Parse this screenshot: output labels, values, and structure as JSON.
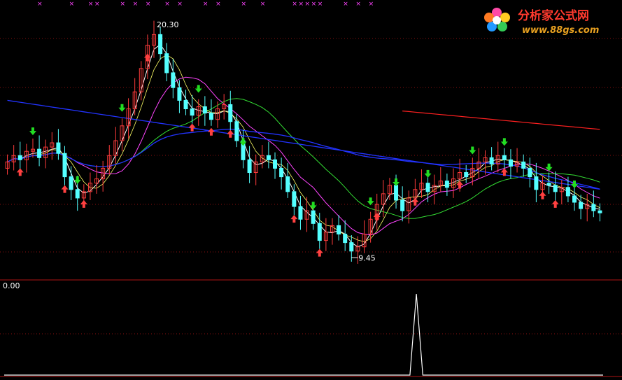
{
  "logo": {
    "title": "分析家公式网",
    "url": "www.88gs.com",
    "title_color": "#ff3a2e",
    "url_color": "#e8a020"
  },
  "indicator": {
    "value_label": "0.00"
  },
  "annotations": {
    "high_label": "20.30",
    "low_label": "9.45",
    "marker_label": "×"
  },
  "colors": {
    "background": "#000000",
    "up_candle": "#ff3b3b",
    "down_candle": "#54ffff",
    "ma_white": "#ffffff",
    "ma_yellow": "#ffff66",
    "ma_magenta": "#ff44ff",
    "ma_green": "#33dd33",
    "ma_blue": "#2233ff",
    "ma_red": "#ff2020",
    "grid": "#8a1010",
    "buy_arrow": "#ff4040",
    "sell_arrow": "#22dd22",
    "marker": "#ff44ff"
  },
  "chart_data": [
    {
      "type": "candlestick",
      "title": "",
      "ylim": [
        9.0,
        21.0
      ],
      "grid": true,
      "candles_close": [
        13.9,
        14.2,
        14.0,
        14.4,
        14.5,
        14.1,
        14.6,
        14.8,
        14.3,
        13.2,
        12.6,
        12.2,
        12.5,
        12.9,
        13.1,
        13.6,
        14.2,
        14.9,
        15.6,
        16.4,
        17.2,
        18.3,
        19.4,
        19.9,
        19.0,
        18.1,
        17.4,
        16.8,
        16.4,
        16.1,
        16.5,
        16.2,
        15.9,
        16.4,
        16.6,
        15.8,
        14.9,
        14.0,
        13.4,
        13.9,
        14.2,
        14.0,
        13.6,
        13.2,
        12.5,
        11.8,
        11.2,
        11.6,
        11.0,
        10.2,
        10.6,
        10.9,
        10.5,
        10.1,
        9.7,
        9.9,
        10.5,
        11.2,
        11.9,
        12.4,
        12.8,
        12.1,
        11.6,
        12.2,
        12.6,
        12.9,
        12.5,
        12.8,
        13.0,
        12.7,
        13.1,
        13.4,
        13.2,
        13.6,
        13.9,
        14.1,
        13.8,
        14.2,
        14.0,
        13.7,
        13.9,
        13.6,
        13.2,
        12.6,
        12.9,
        12.8,
        12.5,
        12.7,
        12.3,
        12.0,
        11.7,
        11.9,
        11.6,
        11.5
      ],
      "markers": {
        "buy": [
          2,
          9,
          12,
          22,
          29,
          32,
          35,
          45,
          49,
          58,
          64,
          71,
          78,
          84,
          86
        ],
        "sell": [
          4,
          11,
          18,
          30,
          37,
          48,
          57,
          61,
          66,
          73,
          78,
          85,
          89
        ],
        "top_marks": [
          5,
          10,
          13,
          14,
          18,
          20,
          22,
          25,
          27,
          31,
          33,
          37,
          40,
          45,
          46,
          47,
          48,
          49,
          53,
          55,
          57
        ]
      },
      "moving_averages": [
        "MA-white",
        "MA-yellow",
        "MA-magenta",
        "MA-green",
        "MA-blue",
        "MA-red"
      ],
      "high": 20.3,
      "low": 9.45
    },
    {
      "type": "line",
      "title": "",
      "values_note": "signal spike",
      "ylim": [
        0,
        1
      ],
      "x": [
        0,
        63,
        64,
        65,
        93
      ],
      "y": [
        0,
        0,
        1,
        0,
        0
      ]
    }
  ]
}
